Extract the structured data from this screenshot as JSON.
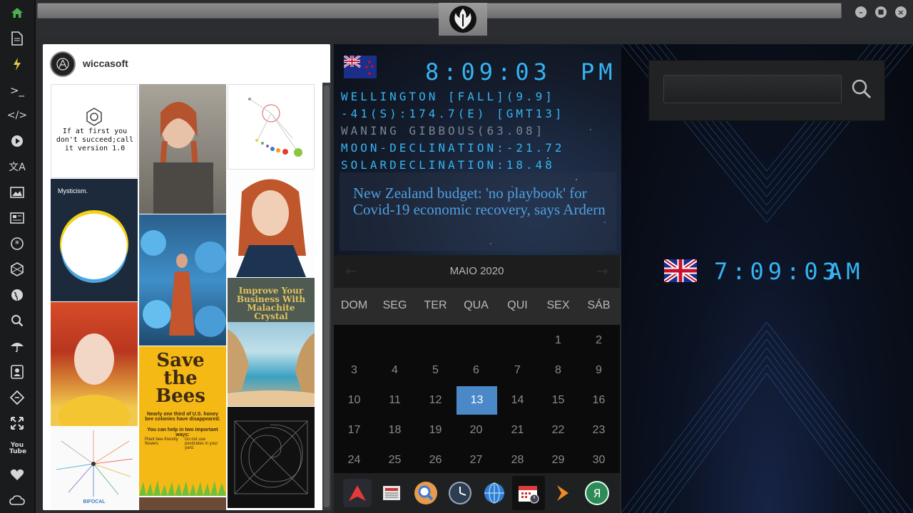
{
  "sidebar": {
    "icons": [
      "home-icon",
      "document-icon",
      "lightning-icon",
      "terminal-icon",
      "code-icon",
      "play-icon",
      "translate-icon",
      "image-icon",
      "news-icon",
      "asterisk-icon",
      "hexagon-icon",
      "globe-icon",
      "search-icon",
      "umbrella-icon",
      "contact-icon",
      "git-icon",
      "fullscreen-icon",
      "youtube-icon",
      "heart-icon",
      "cloud-icon"
    ],
    "youtube_label": "You Tube",
    "home_color": "#4caf50"
  },
  "pinterest": {
    "username": "wiccasoft",
    "tiles": {
      "quote": "If at first you don't succeed;call it version 1.0",
      "mysticism": "Mysticism.",
      "malachite": "Improve Your Business With Malachite Crystal",
      "bees_title": "Save the Bees",
      "bees_sub": "Nearly one third of U.S. honey bee colonies have disappeared.",
      "bees_help": "You can help in two important ways:",
      "bees_1": "Plant bee-friendly flowers",
      "bees_2": "Do not use pesticides in your yard.",
      "bifocal": "BIFOCAL"
    }
  },
  "nz_clock": {
    "time": "8:09:03",
    "ampm": "PM",
    "line1": "WELLINGTON [FALL](9.9]",
    "line2": "-41(S):174.7(E) [GMT13]",
    "line3": "WANING GIBBOUS(63.08]",
    "line4": "MOON-DECLINATION:-21.72",
    "line5": "SOLARDECLINATION:18.48",
    "headline": "New Zealand budget: 'no playbook' for Covid-19 economic recovery, says Ardern"
  },
  "calendar": {
    "month": "MAIO 2020",
    "weekdays": [
      "DOM",
      "SEG",
      "TER",
      "QUA",
      "QUI",
      "SEX",
      "SÁB"
    ],
    "days": [
      "1",
      "2",
      "3",
      "4",
      "5",
      "6",
      "7",
      "8",
      "9",
      "10",
      "11",
      "12",
      "13",
      "14",
      "15",
      "16",
      "17",
      "18",
      "19",
      "20",
      "21",
      "22",
      "23",
      "24",
      "25",
      "26",
      "27",
      "28",
      "29",
      "30"
    ],
    "today": "13",
    "accent": "#4a88c8"
  },
  "dock": {
    "items": [
      "arrow-app-icon",
      "newspaper-icon",
      "magnifier-icon",
      "clock-icon",
      "globe-icon",
      "calendar-icon",
      "play-arrow-icon",
      "ya-icon"
    ],
    "ya_label": "Я"
  },
  "uk_clock": {
    "time": "7:09:03",
    "ampm": "AM"
  },
  "search": {
    "value": "",
    "placeholder": ""
  },
  "colors": {
    "lcd": "#36b4f2",
    "headline": "#4f9fe0"
  }
}
